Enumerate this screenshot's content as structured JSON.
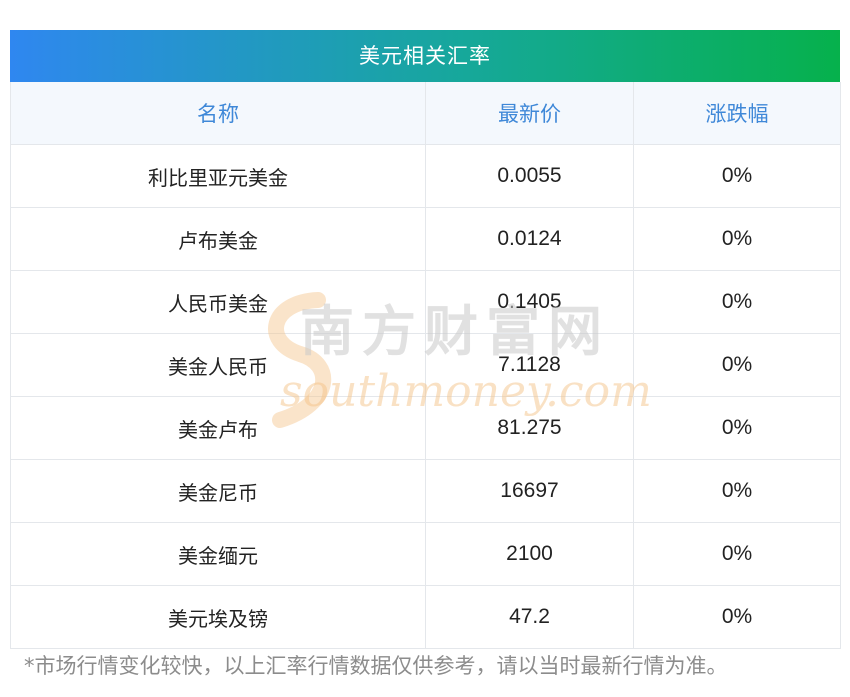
{
  "table": {
    "title": "美元相关汇率",
    "headers": [
      "名称",
      "最新价",
      "涨跌幅"
    ],
    "rows": [
      {
        "name": "利比里亚元美金",
        "price": "0.0055",
        "change": "0%"
      },
      {
        "name": "卢布美金",
        "price": "0.0124",
        "change": "0%"
      },
      {
        "name": "人民币美金",
        "price": "0.1405",
        "change": "0%"
      },
      {
        "name": "美金人民币",
        "price": "7.1128",
        "change": "0%"
      },
      {
        "name": "美金卢布",
        "price": "81.275",
        "change": "0%"
      },
      {
        "name": "美金尼币",
        "price": "16697",
        "change": "0%"
      },
      {
        "name": "美金缅元",
        "price": "2100",
        "change": "0%"
      },
      {
        "name": "美元埃及镑",
        "price": "47.2",
        "change": "0%"
      }
    ]
  },
  "watermark": {
    "cn_text": "南方财富网",
    "en_text": "southmoney.com"
  },
  "footnote": "*市场行情变化较快，以上汇率行情数据仅供参考，请以当时最新行情为准。",
  "colors": {
    "title_gradient_start": "#2f87f0",
    "title_gradient_end": "#06b14c",
    "header_text": "#3f88d8",
    "header_bg": "#f4f8fd",
    "footnote_text": "#8c8c8c"
  }
}
